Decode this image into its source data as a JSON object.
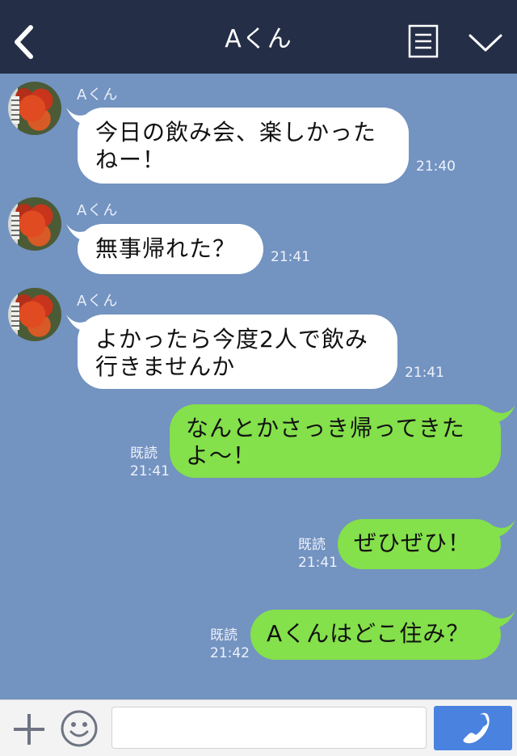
{
  "header": {
    "title": "Aくん",
    "back_icon": "chevron-left-icon",
    "notes_icon": "notes-icon",
    "menu_icon": "chevron-down-icon"
  },
  "messages": [
    {
      "sender": "Aくん",
      "line1": "今日の飲み会、楽しかった",
      "line2": "ねー！",
      "time": "21:40"
    },
    {
      "sender": "Aくん",
      "line1": "無事帰れた？",
      "time": "21:41"
    },
    {
      "sender": "Aくん",
      "line1": "よかったら今度2人で飲み",
      "line2": "行きませんか",
      "time": "21:41"
    },
    {
      "line1": "なんとかさっき帰ってきた",
      "line2": "よ〜！",
      "read": "既読",
      "time": "21:41"
    },
    {
      "line1": "ぜひぜひ！",
      "read": "既読",
      "time": "21:41"
    },
    {
      "line1": "Aくんはどこ住み？",
      "read": "既読",
      "time": "21:42"
    }
  ],
  "footer": {
    "plus_icon": "plus-icon",
    "emoji_icon": "smiley-icon",
    "input_value": "",
    "input_placeholder": "",
    "call_icon": "phone-icon"
  },
  "colors": {
    "background": "#7393c1",
    "header": "#242e47",
    "incoming_bubble": "#ffffff",
    "outgoing_bubble": "#84e04b",
    "call_button": "#4a82df"
  }
}
